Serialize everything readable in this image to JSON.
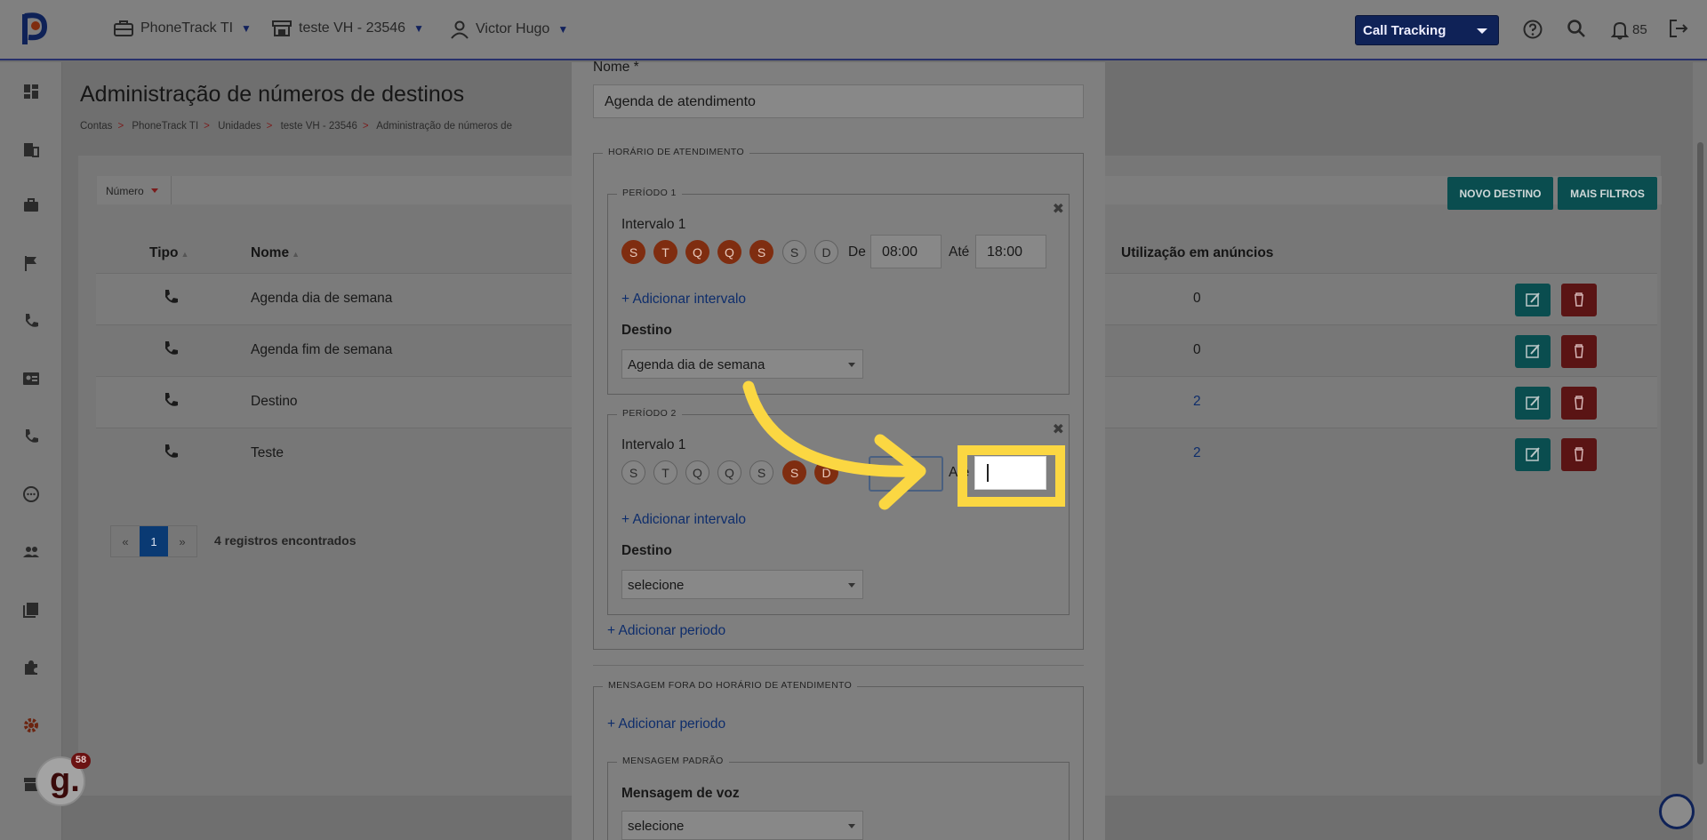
{
  "header": {
    "account": "PhoneTrack TI",
    "unit": "teste VH - 23546",
    "user": "Victor Hugo",
    "product_select": "Call Tracking",
    "notifications_count": "85"
  },
  "page": {
    "title": "Administração de números de destinos",
    "breadcrumb": [
      "Contas",
      "PhoneTrack TI",
      "Unidades",
      "teste VH - 23546",
      "Administração de números de"
    ]
  },
  "filters": {
    "chip": "Número",
    "new_button": "NOVO DESTINO",
    "more_button": "MAIS FILTROS"
  },
  "table": {
    "columns": {
      "tipo": "Tipo",
      "nome": "Nome",
      "uso": "Utilização em anúncios"
    },
    "rows": [
      {
        "nome": "Agenda dia de semana",
        "uso": "0"
      },
      {
        "nome": "Agenda fim de semana",
        "uso": "0"
      },
      {
        "nome": "Destino",
        "uso": "2"
      },
      {
        "nome": "Teste",
        "uso": "2"
      }
    ]
  },
  "pagination": {
    "prev": "«",
    "current": "1",
    "next": "»",
    "records": "4 registros encontrados"
  },
  "modal": {
    "name_label": "Nome *",
    "name_value": "Agenda de atendimento",
    "hours_legend": "HORÁRIO DE ATENDIMENTO",
    "period1": {
      "legend": "PERÍODO 1",
      "interval_label": "Intervalo 1",
      "days": [
        "S",
        "T",
        "Q",
        "Q",
        "S",
        "S",
        "D"
      ],
      "de_label": "De",
      "de_value": "08:00",
      "ate_label": "Até",
      "ate_value": "18:00",
      "add_interval": "Adicionar intervalo",
      "dest_label": "Destino",
      "dest_value": "Agenda dia de semana"
    },
    "period2": {
      "legend": "PERÍODO 2",
      "interval_label": "Intervalo 1",
      "days": [
        "S",
        "T",
        "Q",
        "Q",
        "S",
        "S",
        "D"
      ],
      "de_visible": "0",
      "ate_label": "Até",
      "add_interval": "Adicionar intervalo",
      "dest_label": "Destino",
      "dest_value": "selecione"
    },
    "add_period": "Adicionar periodo",
    "off_hours_legend": "MENSAGEM FORA DO HORÁRIO DE ATENDIMENTO",
    "off_add_period": "Adicionar periodo",
    "default_msg_legend": "MENSAGEM PADRÃO",
    "voice_label": "Mensagem de voz",
    "voice_value": "selecione",
    "close_glyph": "✖",
    "plus_glyph": "+"
  },
  "badge": {
    "letter": "g.",
    "count": "58"
  }
}
